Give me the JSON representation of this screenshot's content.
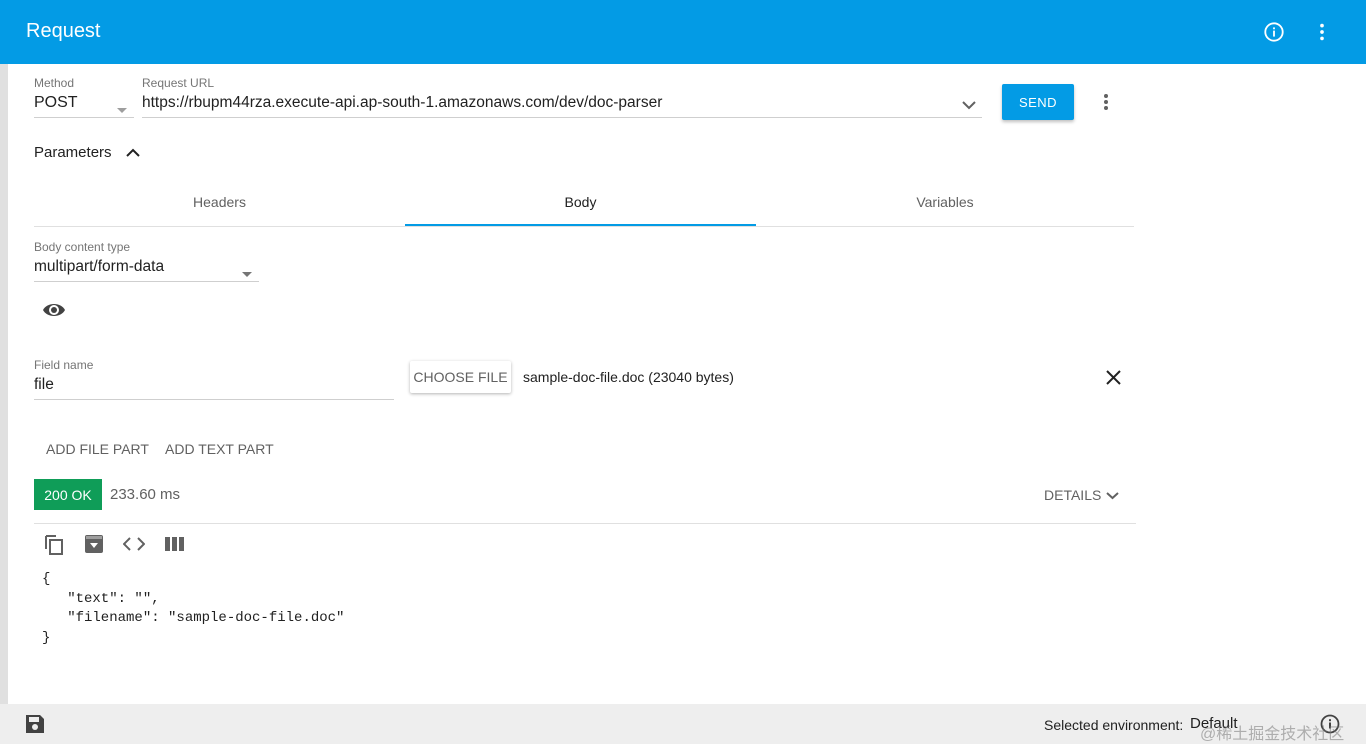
{
  "app": {
    "title": "Request"
  },
  "request": {
    "method_label": "Method",
    "method_value": "POST",
    "url_label": "Request URL",
    "url_value": "https://rbupm44rza.execute-api.ap-south-1.amazonaws.com/dev/doc-parser",
    "send_label": "SEND"
  },
  "parameters": {
    "label": "Parameters"
  },
  "tabs": [
    {
      "label": "Headers"
    },
    {
      "label": "Body",
      "active": true
    },
    {
      "label": "Variables"
    }
  ],
  "body": {
    "content_type_label": "Body content type",
    "content_type_value": "multipart/form-data",
    "field_name_label": "Field name",
    "field_name_value": "file",
    "choose_file_label": "CHOOSE FILE",
    "file_info": "sample-doc-file.doc (23040 bytes)",
    "add_file_part": "ADD FILE PART",
    "add_text_part": "ADD TEXT PART"
  },
  "response": {
    "status": "200 OK",
    "time": "233.60 ms",
    "details_label": "DETAILS",
    "code_lines": [
      "{",
      "   \"text\": \"\",",
      "   \"filename\": \"sample-doc-file.doc\"",
      "}"
    ]
  },
  "footer": {
    "env_label": "Selected environment:",
    "env_value": "Default",
    "watermark": "@稀土掘金技术社区"
  },
  "colors": {
    "primary": "#039be5",
    "success": "#0f9d58"
  },
  "icons": [
    "info-icon",
    "more-vert-icon",
    "chevron-down-icon",
    "chevron-up-icon",
    "eye-icon",
    "close-icon",
    "copy-icon",
    "download-icon",
    "code-icon",
    "columns-icon",
    "save-icon"
  ]
}
